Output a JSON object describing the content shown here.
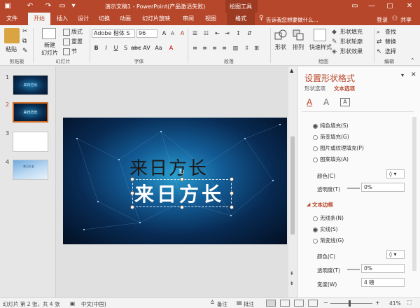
{
  "titlebar": {
    "title": "演示文稿1 - PowerPoint(产品激活失败)",
    "context_tab": "绘图工具"
  },
  "tabs": {
    "file": "文件",
    "home": "开始",
    "insert": "插入",
    "design": "设计",
    "transitions": "切换",
    "animations": "动画",
    "slideshow": "幻灯片放映",
    "review": "审阅",
    "view": "视图",
    "format": "格式",
    "tell_me": "告诉我您想要做什么...",
    "login": "登录",
    "share": "共享"
  },
  "ribbon": {
    "paste": "粘贴",
    "clipboard": "剪贴板",
    "new_slide": "新建\n幻灯片",
    "layout": "版式",
    "reset": "重置",
    "section": "节",
    "slides_group": "幻灯片",
    "font_name": "Adobe 楷体 S",
    "font_size": "96",
    "font_group": "字体",
    "paragraph_group": "段落",
    "shape": "形状",
    "arrange": "排列",
    "quick_styles": "快速样式",
    "shape_fill": "形状填充",
    "shape_outline": "形状轮廓",
    "shape_effects": "形状效果",
    "drawing_group": "绘图",
    "find": "查找",
    "replace": "替换",
    "select": "选择",
    "editing_group": "编辑"
  },
  "slides": [
    {
      "num": "1",
      "text": "来日方长"
    },
    {
      "num": "2",
      "text": "来日方长"
    },
    {
      "num": "3",
      "text": ""
    },
    {
      "num": "4",
      "text": "来日方长"
    }
  ],
  "slide": {
    "title_text": "来日方长",
    "subtitle_text": "来日方长"
  },
  "pane": {
    "title": "设置形状格式",
    "tab_shape": "形状选项",
    "tab_text": "文本选项",
    "fill_options": [
      "纯色填充(S)",
      "渐变填充(G)",
      "图片或纹理填充(P)",
      "图案填充(A)"
    ],
    "fill_color_label": "颜色(C)",
    "fill_transparency_label": "透明度(T)",
    "fill_transparency_value": "0%",
    "outline_section": "文本边框",
    "outline_options": [
      "无线条(N)",
      "实线(S)",
      "渐变线(G)"
    ],
    "outline_color_label": "颜色(C)",
    "outline_transparency_label": "透明度(T)",
    "outline_transparency_value": "0%",
    "width_label": "宽度(W)",
    "width_value": "4 磅"
  },
  "status": {
    "slide_info": "幻灯片 第 2 张，共 4 张",
    "language": "中文(中国)",
    "notes": "备注",
    "comments": "批注",
    "zoom": "41%"
  },
  "colors": {
    "accent": "#b7472a",
    "slide_bg_dark": "#061a33",
    "slide_bg_light": "#1f7fb0"
  }
}
